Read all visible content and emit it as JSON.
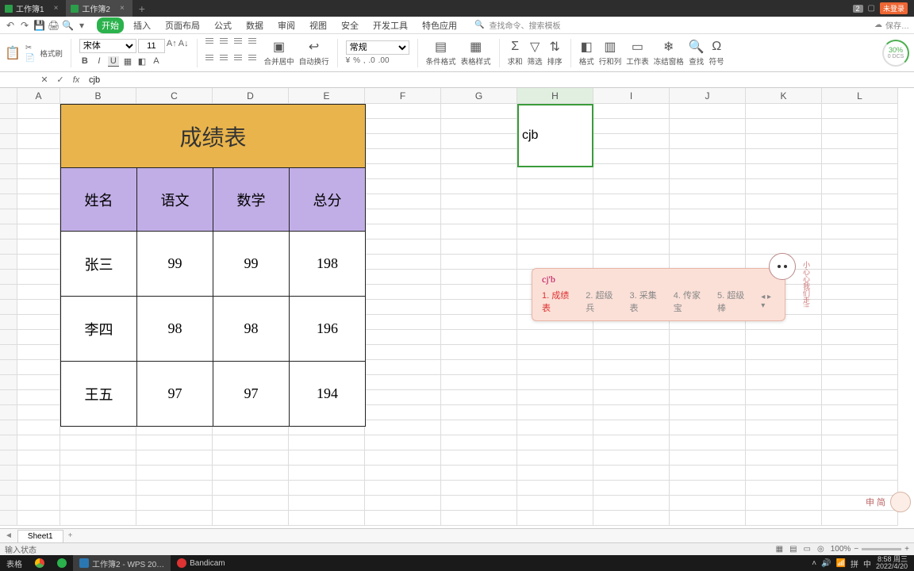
{
  "titlebar": {
    "tabs": [
      {
        "label": "工作簿1"
      },
      {
        "label": "工作簿2"
      }
    ],
    "loginBadge": "未登录",
    "numBadge": "2"
  },
  "menu": {
    "tabs": [
      "开始",
      "插入",
      "页面布局",
      "公式",
      "数据",
      "审阅",
      "视图",
      "安全",
      "开发工具",
      "特色应用"
    ],
    "search": "查找命令、搜索模板",
    "saveHint": "保存…"
  },
  "ribbon": {
    "copyGroup": {
      "paste": "粘贴",
      "fmtBrush": "格式刷"
    },
    "fontName": "宋体",
    "fontSize": "11",
    "mergeLabel": "合并居中",
    "wrapLabel": "自动换行",
    "numberFormat": "常规",
    "cond": "条件格式",
    "tableFmt": "表格样式",
    "sum": "求和",
    "filter": "筛选",
    "sort": "排序",
    "format": "格式",
    "rowcol": "行和列",
    "sheet": "工作表",
    "freeze": "冻结窗格",
    "find": "查找",
    "symbol": "符号",
    "progress": "30%",
    "progressSub": "0 DCS"
  },
  "formulaBar": {
    "nameBox": "",
    "content": "cjb"
  },
  "columns": {
    "labels": [
      "A",
      "B",
      "C",
      "D",
      "E",
      "F",
      "G",
      "H",
      "I",
      "J",
      "K",
      "L"
    ],
    "widths": [
      54,
      96,
      96,
      96,
      96,
      96,
      96,
      96,
      96,
      96,
      96,
      96
    ],
    "selected": "H"
  },
  "activeCell": {
    "ref": "H",
    "value": "cjb"
  },
  "ime": {
    "composition": "cj'b",
    "candidates": [
      "成绩表",
      "超级兵",
      "采集表",
      "传家宝",
      "超级棒"
    ],
    "note": "小心心我们走!!"
  },
  "chart_data": {
    "type": "table",
    "title": "成绩表",
    "headers": [
      "姓名",
      "语文",
      "数学",
      "总分"
    ],
    "rows": [
      [
        "张三",
        99,
        99,
        198
      ],
      [
        "李四",
        98,
        98,
        196
      ],
      [
        "王五",
        97,
        97,
        194
      ]
    ]
  },
  "sheetTabs": {
    "active": "Sheet1"
  },
  "status": {
    "left": "输入状态",
    "zoom": "100%"
  },
  "taskbar": {
    "items": [
      {
        "label": ""
      },
      {
        "label": ""
      },
      {
        "label": "工作簿2 - WPS 20…"
      },
      {
        "label": "Bandicam"
      }
    ],
    "clockTime": "8:58 周三",
    "clockDate": "2022/4/20",
    "langs": [
      "拼",
      "中"
    ]
  },
  "misc": {
    "leftCut": "表格",
    "rightChars": "申 简"
  }
}
